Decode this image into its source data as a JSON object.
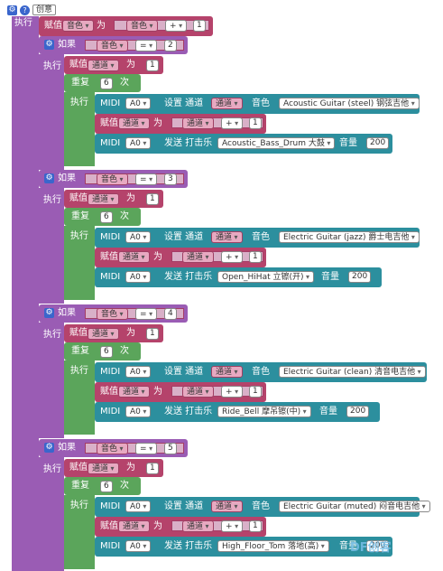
{
  "header": {
    "title": "创意"
  },
  "blocks": {
    "execute_label": "执行",
    "assign_label": "赋值",
    "for_label": "为",
    "if_label": "如果",
    "repeat_label": "重复",
    "times_label": "次",
    "midi_label": "MIDI",
    "set_channel_label": "设置 通道",
    "timbre_label": "音色",
    "send_percussion_label": "发送 打击乐",
    "volume_label": "音量",
    "var_timbre": "音色",
    "var_channel": "通道",
    "op_plus": "+",
    "op_eq": "=",
    "pin": "A0",
    "one": "1",
    "repeat_count": "6"
  },
  "top_assign": {
    "value": "1"
  },
  "sections": [
    {
      "cond": "2",
      "channel_init": "1",
      "instrument": "Acoustic Guitar (steel) 钢弦吉他",
      "drum": "Acoustic_Bass_Drum 大鼓",
      "volume": "200"
    },
    {
      "cond": "3",
      "channel_init": "1",
      "instrument": "Electric Guitar (jazz) 爵士电吉他",
      "drum": "Open_HiHat 立镲(开)",
      "volume": "200"
    },
    {
      "cond": "4",
      "channel_init": "1",
      "instrument": "Electric Guitar (clean) 清音电吉他",
      "drum": "Ride_Bell 摩吊镲(中)",
      "volume": "200"
    },
    {
      "cond": "5",
      "channel_init": "1",
      "instrument": "Electric Guitar (muted) 闷音电吉他",
      "drum": "High_Floor_Tom 落地(高)",
      "volume": "200"
    }
  ],
  "watermark": {
    "text": "DF创客"
  }
}
